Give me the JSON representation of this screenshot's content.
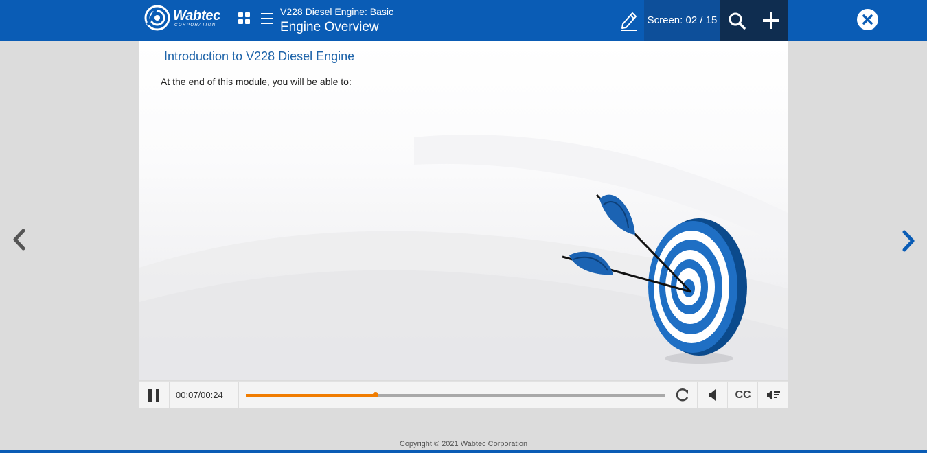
{
  "header": {
    "logo_text": "Wabtec",
    "logo_sub": "CORPORATION",
    "course_title": "V228 Diesel Engine: Basic",
    "module_title": "Engine Overview",
    "screen_counter": "Screen: 02 / 15",
    "icons": [
      "grid-icon",
      "menu-icon",
      "pencil-icon",
      "search-icon",
      "plus-icon",
      "close-icon"
    ]
  },
  "slide": {
    "title": "Introduction to V228 Diesel Engine",
    "body": "At the end of this module, you will be able to:"
  },
  "player": {
    "elapsed": "00:07",
    "separator": "/",
    "total": "00:24",
    "progress": 0.31,
    "cc_label": "CC",
    "icons": [
      "pause-icon",
      "replay-icon",
      "volume-icon",
      "cc-icon",
      "transcript-icon"
    ]
  },
  "navigation": {
    "icons": [
      "chevron-left-icon",
      "chevron-right-icon"
    ]
  },
  "footer": {
    "copyright": "Copyright © 2021 Wabtec Corporation"
  },
  "colors": {
    "brand_blue": "#0a5cb5",
    "dark_navy": "#0f2d50",
    "progress_orange": "#f07c00",
    "title_blue": "#1d63a9"
  }
}
